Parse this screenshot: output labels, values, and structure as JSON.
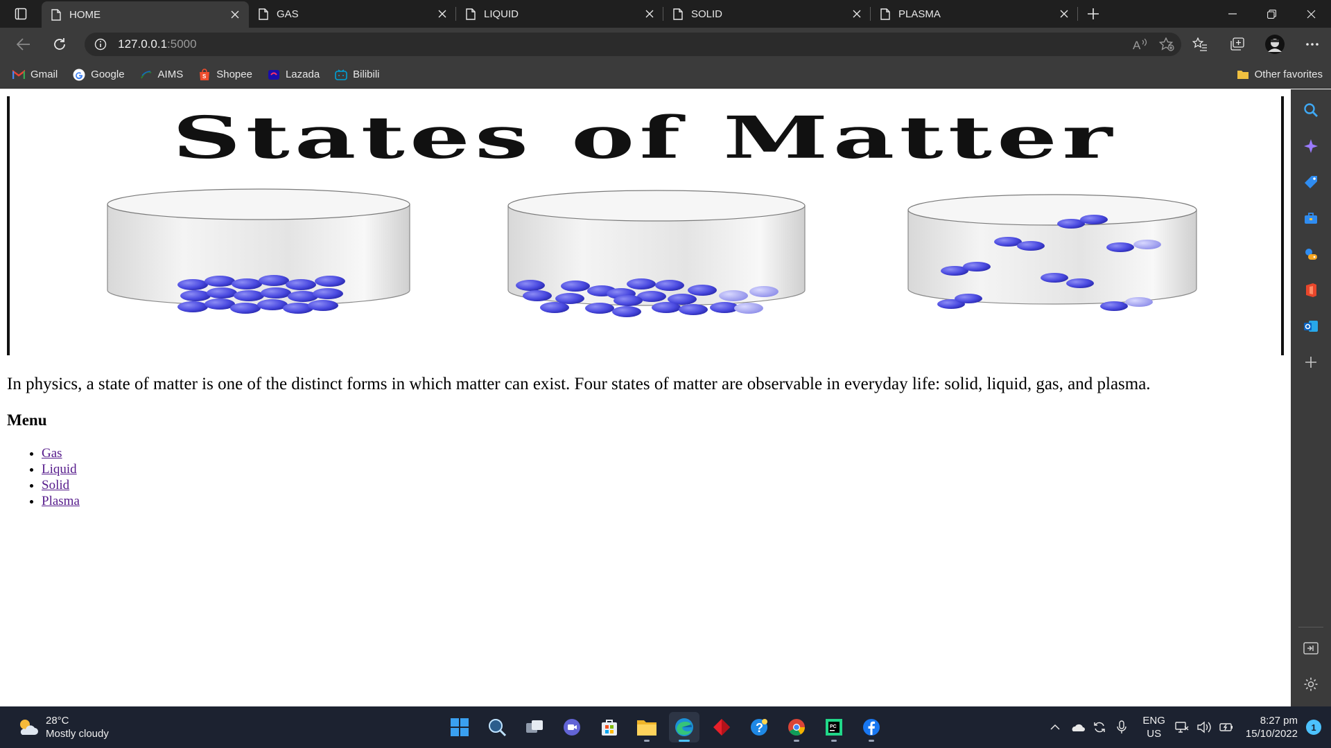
{
  "browser": {
    "tabs": [
      {
        "title": "HOME",
        "active": true
      },
      {
        "title": "GAS",
        "active": false
      },
      {
        "title": "LIQUID",
        "active": false
      },
      {
        "title": "SOLID",
        "active": false
      },
      {
        "title": "PLASMA",
        "active": false
      }
    ],
    "address": {
      "host": "127.0.0.1",
      "port": ":5000"
    },
    "favorites": [
      {
        "label": "Gmail",
        "icon": "gmail-icon",
        "color": "#ea4335"
      },
      {
        "label": "Google",
        "icon": "google-icon",
        "color": "#4285f4"
      },
      {
        "label": "AIMS",
        "icon": "aims-icon",
        "color": "#2e7d32"
      },
      {
        "label": "Shopee",
        "icon": "shopee-icon",
        "color": "#ee4d2d"
      },
      {
        "label": "Lazada",
        "icon": "lazada-icon",
        "color": "#1a0dab"
      },
      {
        "label": "Bilibili",
        "icon": "bilibili-icon",
        "color": "#00a1d6"
      }
    ],
    "other_favorites": "Other favorites"
  },
  "page": {
    "banner_title": "States of Matter",
    "intro": "In physics, a state of matter is one of the distinct forms in which matter can exist. Four states of matter are observable in everyday life: solid, liquid, gas, and plasma.",
    "menu_heading": "Menu",
    "menu_items": [
      "Gas",
      "Liquid",
      "Solid",
      "Plasma"
    ]
  },
  "taskbar": {
    "weather": {
      "temp": "28°C",
      "condition": "Mostly cloudy"
    },
    "language": {
      "lang": "ENG",
      "region": "US"
    },
    "clock": {
      "time": "8:27 pm",
      "date": "15/10/2022"
    },
    "notifications": "1"
  }
}
